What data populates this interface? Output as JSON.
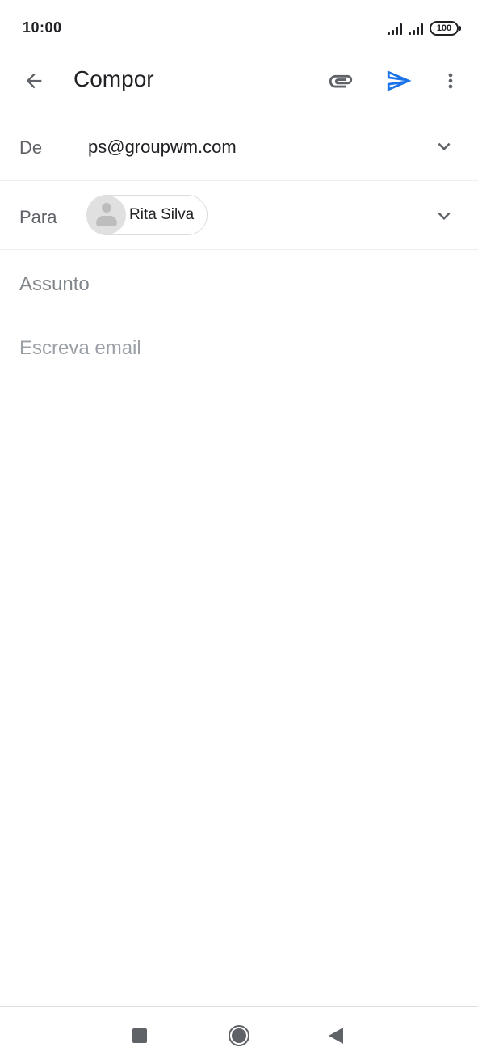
{
  "status_bar": {
    "time": "10:00",
    "battery": "100"
  },
  "app_bar": {
    "title": "Compor",
    "icons": {
      "back": "arrow-back-icon",
      "attach": "paperclip-icon",
      "send": "send-icon",
      "more": "more-vert-icon"
    }
  },
  "compose": {
    "from_label": "De",
    "from_value": "ps@groupwm.com",
    "to_label": "Para",
    "recipients": [
      {
        "name": "Rita Silva"
      }
    ],
    "subject_placeholder": "Assunto",
    "subject_value": "",
    "body_placeholder": "Escreva email",
    "body_value": ""
  },
  "colors": {
    "accent": "#1a73e8",
    "icon": "#5f6368",
    "text": "#202124",
    "placeholder": "#80868b"
  }
}
